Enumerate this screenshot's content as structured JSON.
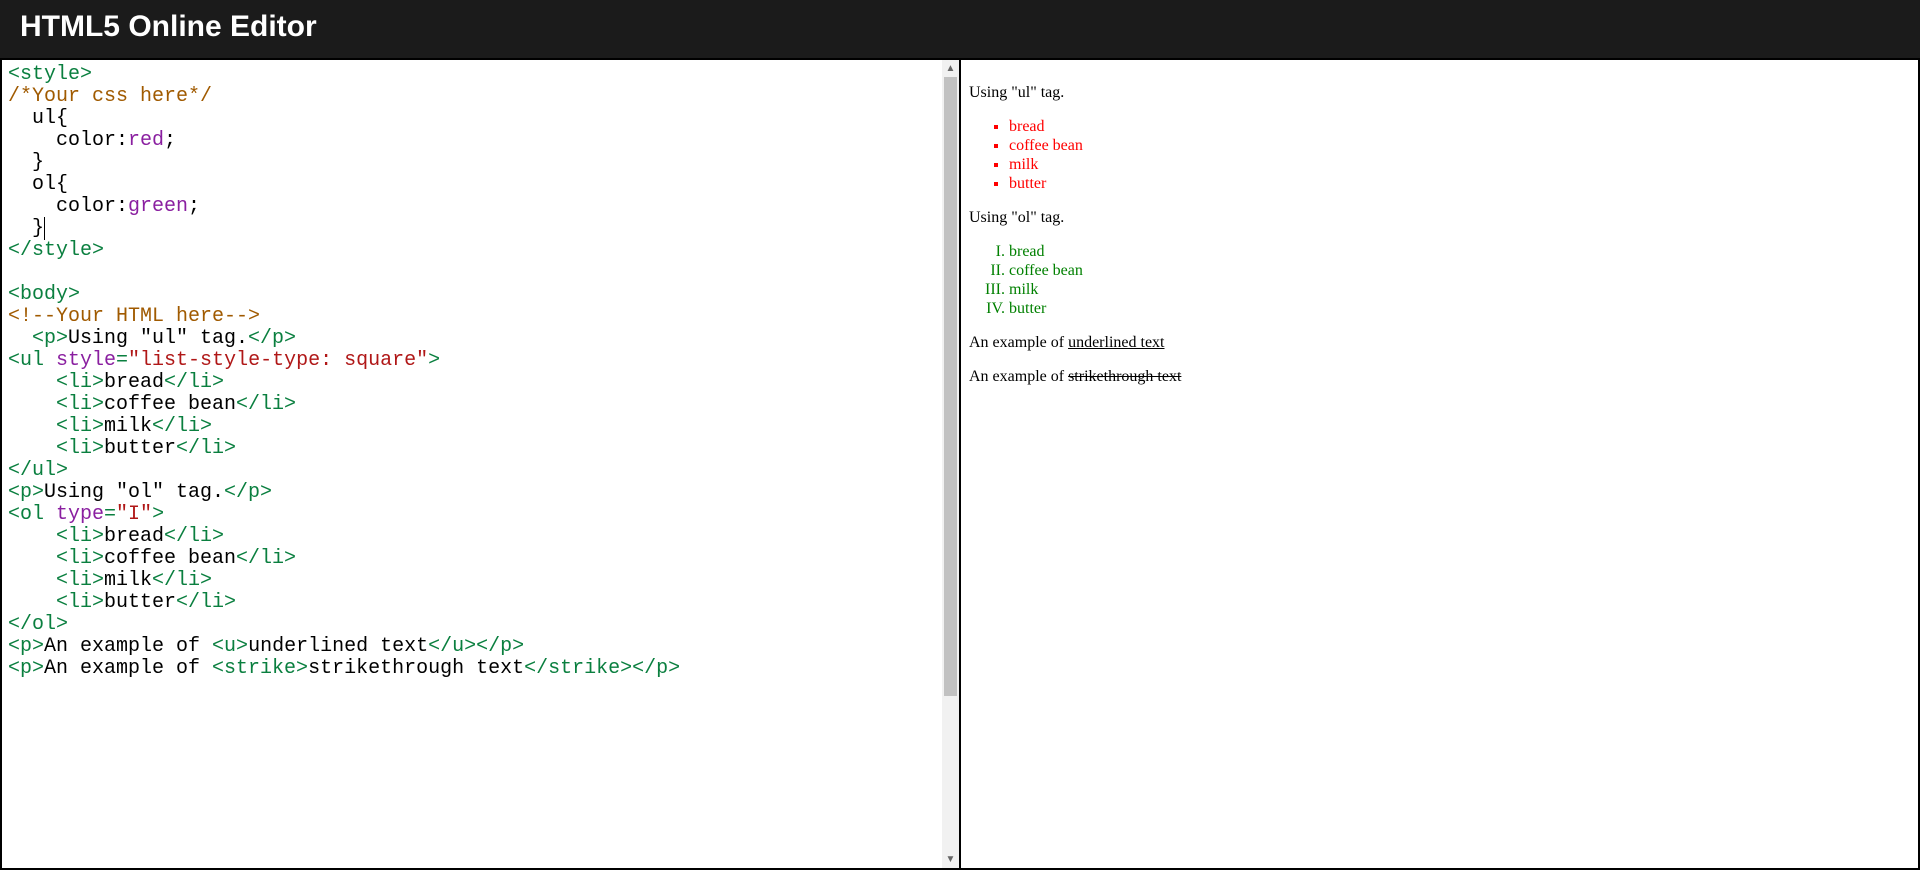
{
  "header": {
    "title": "HTML5 Online Editor"
  },
  "code": {
    "l1_open": "<style>",
    "l2_comm": "/*Your css here*/",
    "l3": "  ul{",
    "l4a": "    color:",
    "l4b": "red",
    "l4c": ";",
    "l5": "  }",
    "l6": "  ol{",
    "l7a": "    color:",
    "l7b": "green",
    "l7c": ";",
    "l8": "  }",
    "l9_close": "</style>",
    "l11_open": "<body>",
    "l12_comm": "<!--Your HTML here-->",
    "l13a": "  <p>",
    "l13b": "Using \"ul\" tag.",
    "l13c": "</p>",
    "l14a": "<ul ",
    "l14b": "style",
    "l14c": "=",
    "l14d": "\"list-style-type: square\"",
    "l14e": ">",
    "l15a": "    <li>",
    "l15b": "bread",
    "l15c": "</li>",
    "l16a": "    <li>",
    "l16b": "coffee bean",
    "l16c": "</li>",
    "l17a": "    <li>",
    "l17b": "milk",
    "l17c": "</li>",
    "l18a": "    <li>",
    "l18b": "butter",
    "l18c": "</li>",
    "l19": "</ul>",
    "l20a": "<p>",
    "l20b": "Using \"ol\" tag.",
    "l20c": "</p>",
    "l21a": "<ol ",
    "l21b": "type",
    "l21c": "=",
    "l21d": "\"I\"",
    "l21e": ">",
    "l22a": "    <li>",
    "l22b": "bread",
    "l22c": "</li>",
    "l23a": "    <li>",
    "l23b": "coffee bean",
    "l23c": "</li>",
    "l24a": "    <li>",
    "l24b": "milk",
    "l24c": "</li>",
    "l25a": "    <li>",
    "l25b": "butter",
    "l25c": "</li>",
    "l26": "</ol>",
    "l27a": "<p>",
    "l27b": "An example of ",
    "l27c": "<u>",
    "l27d": "underlined text",
    "l27e": "</u>",
    "l27f": "</p>",
    "l28a": "<p>",
    "l28b": "An example of ",
    "l28c": "<strike>",
    "l28d": "strikethrough text",
    "l28e": "</strike>",
    "l28f": "</p>"
  },
  "preview": {
    "p_ul": "Using \"ul\" tag.",
    "ul_items": {
      "0": "bread",
      "1": "coffee bean",
      "2": "milk",
      "3": "butter"
    },
    "p_ol": "Using \"ol\" tag.",
    "ol_items": {
      "0": "bread",
      "1": "coffee bean",
      "2": "milk",
      "3": "butter"
    },
    "p_u_pre": "An example of ",
    "p_u": "underlined text",
    "p_s_pre": "An example of ",
    "p_s": "strikethrough text"
  }
}
